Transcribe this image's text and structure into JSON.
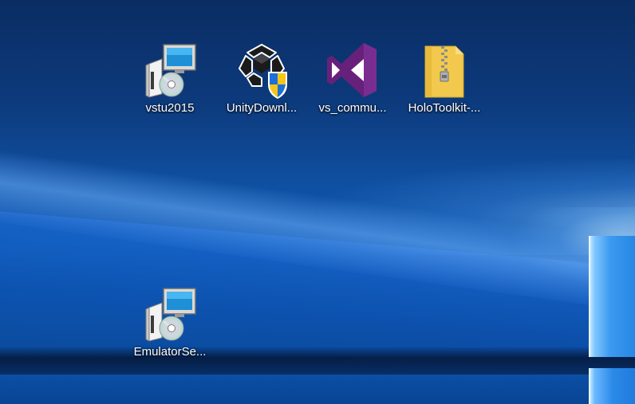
{
  "desktop": {
    "icons": [
      {
        "label": "vstu2015",
        "icon": "installer-icon"
      },
      {
        "label": "UnityDownl...",
        "icon": "unity-installer-icon"
      },
      {
        "label": "vs_commu...",
        "icon": "visual-studio-icon"
      },
      {
        "label": "HoloToolkit-...",
        "icon": "zip-folder-icon"
      },
      {
        "label": "EmulatorSe...",
        "icon": "installer-icon"
      }
    ]
  },
  "colors": {
    "wallpaper_dark": "#0a2d63",
    "wallpaper_mid": "#0f4fa0",
    "vs_purple": "#68217a",
    "folder_yellow": "#f2c94c",
    "label_text": "#ffffff"
  }
}
